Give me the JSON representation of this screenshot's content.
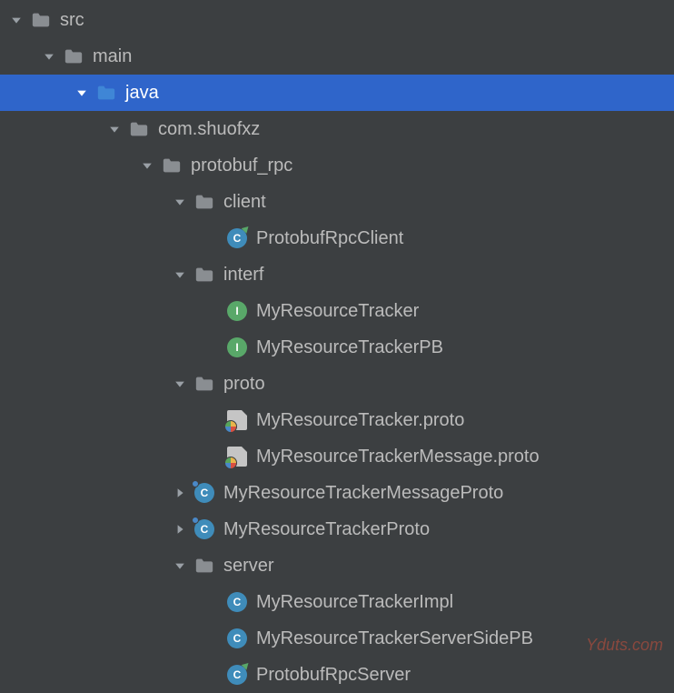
{
  "accent_color": "#2f65ca",
  "icon_palette": {
    "folder": "#8a8e92",
    "source_folder": "#3f86d6",
    "class": "#3f8cba",
    "interface": "#59a869",
    "file": "#c5c5c5"
  },
  "tree": [
    {
      "indent": 0,
      "arrow": "down",
      "icon": "folder",
      "label": "src",
      "name": "folder-src",
      "selected": false
    },
    {
      "indent": 1,
      "arrow": "down",
      "icon": "folder",
      "label": "main",
      "name": "folder-main",
      "selected": false
    },
    {
      "indent": 2,
      "arrow": "down",
      "icon": "source-folder",
      "label": "java",
      "name": "folder-java",
      "selected": true
    },
    {
      "indent": 3,
      "arrow": "down",
      "icon": "package",
      "label": "com.shuofxz",
      "name": "package-com-shuofxz",
      "selected": false
    },
    {
      "indent": 4,
      "arrow": "down",
      "icon": "package",
      "label": "protobuf_rpc",
      "name": "package-protobuf-rpc",
      "selected": false
    },
    {
      "indent": 5,
      "arrow": "down",
      "icon": "package",
      "label": "client",
      "name": "package-client",
      "selected": false
    },
    {
      "indent": 6,
      "arrow": "none",
      "icon": "class-runnable",
      "label": "ProtobufRpcClient",
      "name": "class-protobuf-rpc-client",
      "selected": false
    },
    {
      "indent": 5,
      "arrow": "down",
      "icon": "package",
      "label": "interf",
      "name": "package-interf",
      "selected": false
    },
    {
      "indent": 6,
      "arrow": "none",
      "icon": "interface",
      "label": "MyResourceTracker",
      "name": "interface-my-resource-tracker",
      "selected": false
    },
    {
      "indent": 6,
      "arrow": "none",
      "icon": "interface",
      "label": "MyResourceTrackerPB",
      "name": "interface-my-resource-tracker-pb",
      "selected": false
    },
    {
      "indent": 5,
      "arrow": "down",
      "icon": "package",
      "label": "proto",
      "name": "package-proto",
      "selected": false
    },
    {
      "indent": 6,
      "arrow": "none",
      "icon": "proto-file",
      "label": "MyResourceTracker.proto",
      "name": "file-my-resource-tracker-proto",
      "selected": false
    },
    {
      "indent": 6,
      "arrow": "none",
      "icon": "proto-file",
      "label": "MyResourceTrackerMessage.proto",
      "name": "file-my-resource-tracker-message-proto",
      "selected": false
    },
    {
      "indent": 5,
      "arrow": "right",
      "icon": "class-generated",
      "label": "MyResourceTrackerMessageProto",
      "name": "class-my-resource-tracker-message-proto",
      "selected": false
    },
    {
      "indent": 5,
      "arrow": "right",
      "icon": "class-generated",
      "label": "MyResourceTrackerProto",
      "name": "class-my-resource-tracker-proto",
      "selected": false
    },
    {
      "indent": 5,
      "arrow": "down",
      "icon": "package",
      "label": "server",
      "name": "package-server",
      "selected": false
    },
    {
      "indent": 6,
      "arrow": "none",
      "icon": "class",
      "label": "MyResourceTrackerImpl",
      "name": "class-my-resource-tracker-impl",
      "selected": false
    },
    {
      "indent": 6,
      "arrow": "none",
      "icon": "class",
      "label": "MyResourceTrackerServerSidePB",
      "name": "class-my-resource-tracker-server-side-pb",
      "selected": false
    },
    {
      "indent": 6,
      "arrow": "none",
      "icon": "class-runnable",
      "label": "ProtobufRpcServer",
      "name": "class-protobuf-rpc-server",
      "selected": false
    }
  ],
  "watermark": "Yduts.com"
}
